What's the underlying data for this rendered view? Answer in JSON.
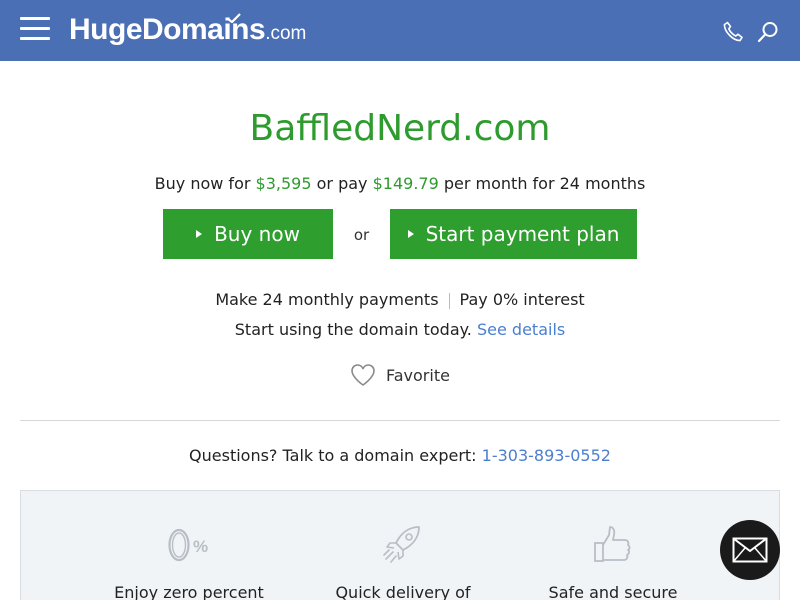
{
  "header": {
    "logo_main": "HugeDomains",
    "logo_tld": ".com",
    "bg_color": "#4a6fb5",
    "icons": [
      "menu-icon",
      "phone-icon",
      "search-icon"
    ]
  },
  "domain": {
    "name": "BaffledNerd.com",
    "color": "#2e9b2e"
  },
  "pricing": {
    "prefix": "Buy now for",
    "buy_price": "$3,595",
    "middle": "or pay",
    "monthly_price": "$149.79",
    "suffix": "per month for 24 months"
  },
  "actions": {
    "buy_label": "Buy now",
    "or_label": "or",
    "plan_label": "Start payment plan",
    "button_color": "#2e9e2e"
  },
  "info": {
    "payments": "Make 24 monthly payments",
    "interest": "Pay 0% interest",
    "start_text": "Start using the domain today.",
    "details_link": "See details",
    "link_color": "#4a7fd1"
  },
  "favorite": {
    "label": "Favorite"
  },
  "contact": {
    "question": "Questions? Talk to a domain expert:",
    "phone": "1-303-893-0552"
  },
  "features": [
    {
      "icon": "zero-percent-icon",
      "label": "Enjoy zero percent"
    },
    {
      "icon": "rocket-icon",
      "label": "Quick delivery of"
    },
    {
      "icon": "thumbs-up-icon",
      "label": "Safe and secure"
    }
  ],
  "chat": {
    "icon": "envelope-icon"
  }
}
